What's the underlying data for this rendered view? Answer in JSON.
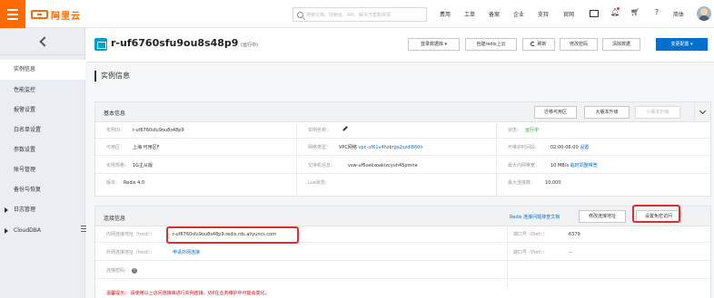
{
  "topbar": {
    "logo_text": "阿里云",
    "search_placeholder": "搜索文档、控制台、API、解决方案和资源",
    "links": {
      "fees": "费用",
      "tickets": "工单",
      "filing": "备案",
      "enterprise": "企业",
      "support": "支持",
      "official_site": "官网",
      "language": "简体"
    }
  },
  "sidebar": {
    "items": [
      {
        "label": "实例信息"
      },
      {
        "label": "性能监控"
      },
      {
        "label": "报警设置"
      },
      {
        "label": "白名单设置"
      },
      {
        "label": "参数设置"
      },
      {
        "label": "账号管理"
      },
      {
        "label": "备份与恢复"
      }
    ],
    "groups": [
      {
        "label": "日志管理"
      },
      {
        "label": "CloudDBA"
      }
    ]
  },
  "header": {
    "instance_id": "r-uf6760sfu9ou8s48p9",
    "status": "(运行中)",
    "buttons": {
      "login_db": "登录数据库",
      "migrate": "自建redis上云",
      "refresh": "刷新",
      "change_password": "修改密码",
      "clear_data": "清除数据",
      "change_config": "变更配置"
    }
  },
  "page": {
    "section_title": "实例信息"
  },
  "basic": {
    "title": "基本信息",
    "buttons": {
      "migrate_zone": "迁移可用区",
      "major_upgrade": "大版本升级",
      "minor_upgrade": "小版本升级"
    },
    "rows": [
      [
        {
          "label": "实例ID：",
          "value": "r-uf6760sfu9ou8s48p9"
        },
        {
          "label": "实例名称：",
          "value": ""
        },
        {
          "label": "状态：",
          "value": "运行中"
        }
      ],
      [
        {
          "label": "可用区：",
          "value": "上海 可用区F"
        },
        {
          "label": "网络类型：",
          "value": "VPC网络",
          "link": "vpc-uf61v4hzbrga2szdl860h"
        },
        {
          "label": "可维护时间段：",
          "value": "02:00-06:00",
          "link": "设置"
        }
      ],
      [
        {
          "label": "实例规格：",
          "value": "1G主从版"
        },
        {
          "label": "交换机信息：",
          "value": "vsw-uf6oxksoakizcyuh45pmne"
        },
        {
          "label": "最大内网带宽：",
          "value": "10 MB/s",
          "link": "临时调整带宽"
        }
      ],
      [
        {
          "label": "版本：",
          "value": "Redis 4.0"
        },
        {
          "label": "Lua状态：",
          "value": ""
        },
        {
          "label": "最大连接数：",
          "value": "10,000"
        }
      ]
    ]
  },
  "connection": {
    "title": "连接信息",
    "doc_link": "Redis 连接问题排查文档",
    "buttons": {
      "modify_address": "修改连接地址",
      "password_free": "设置免密访问"
    },
    "rows": [
      {
        "label": "内网连接地址（host）：",
        "value": "r-uf6760sfu9ou8s48p9.redis.rds.aliyuncs.com",
        "port_label": "端口号（Port）：",
        "port_value": "6379"
      },
      {
        "label": "外网连接地址（host）：",
        "link": "申请外网连接",
        "port_label": "端口号（Port）：",
        "port_value": "--"
      },
      {
        "label": "连接密码：",
        "value": ""
      }
    ],
    "warning": "温馨提示： 请使用以上访问连接串进行实例连接，VIP在业务维护中可能会变化。"
  },
  "colors": {
    "brand": "#ff6a00",
    "primary": "#0070cc",
    "ok": "#2aa143",
    "highlight_border": "#d9302c"
  }
}
